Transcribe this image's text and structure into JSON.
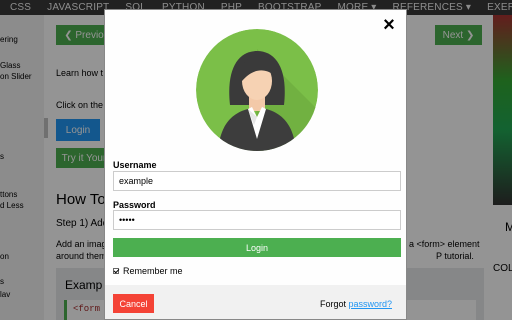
{
  "topnav": {
    "items": [
      "CSS",
      "JAVASCRIPT",
      "SQL",
      "PYTHON",
      "PHP",
      "BOOTSTRAP",
      "MORE ▾",
      "REFERENCES ▾",
      "EXERCISES ▾"
    ]
  },
  "sidebar": {
    "items": [
      "ering",
      "Glass",
      "on Slider",
      "s",
      "ttons",
      "d Less",
      "on",
      "s",
      "lav"
    ]
  },
  "content": {
    "prev_label": "❮ Previo",
    "next_label": "Next ❯",
    "learn_text": "Learn how t",
    "click_text": "Click on the",
    "login_label": "Login",
    "try_label": "Try it Your",
    "heading": "How To",
    "step": "Step 1) Add",
    "add_text": "Add an imag",
    "around_text": "around them",
    "form_element_text": "a <form> element",
    "tutorial_text": "P tutorial.",
    "example_label": "Examp",
    "code": "<form",
    "right_col": "COL",
    "right_M": "M"
  },
  "modal": {
    "close_glyph": "×",
    "avatar_icon": "female-avatar-icon",
    "username_label": "Username",
    "username_value": "example",
    "password_label": "Password",
    "password_value": "•••••",
    "login_button": "Login",
    "remember_label": "Remember me",
    "cancel_button": "Cancel",
    "forgot_prefix": "Forgot ",
    "forgot_link": "password?"
  },
  "colors": {
    "green": "#4caf50",
    "red": "#f44336",
    "blue": "#2196f3",
    "nav": "#3a3a3a"
  }
}
